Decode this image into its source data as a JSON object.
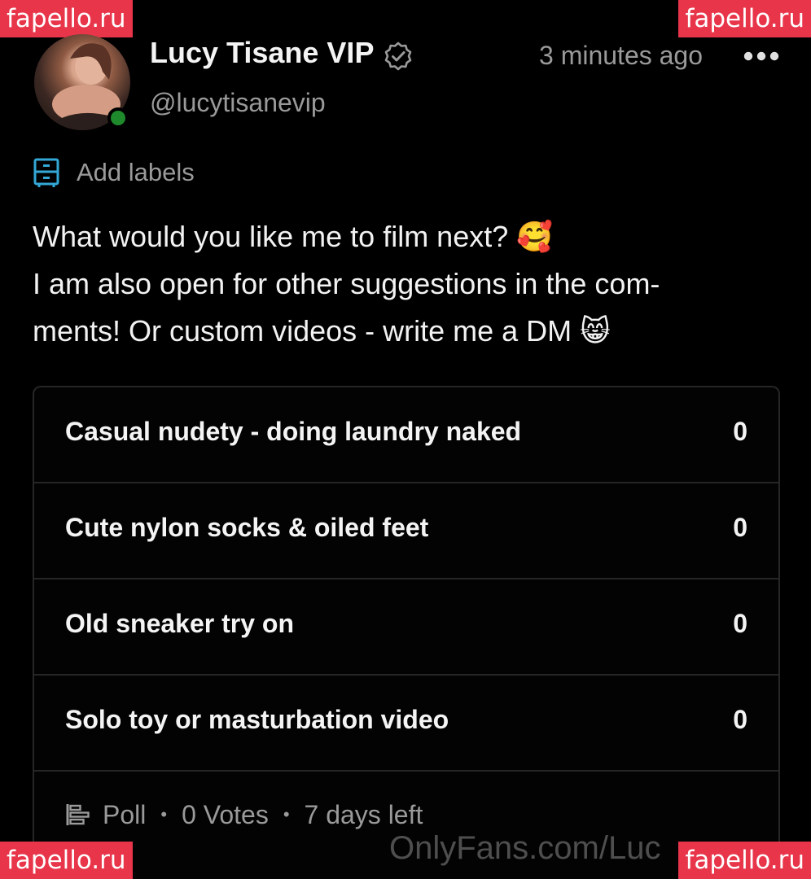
{
  "watermarks": {
    "top_left": "fapello.ru",
    "top_right": "fapello.ru",
    "bottom_left": "fapello.ru",
    "bottom_right": "fapello.ru",
    "site": "OnlyFans.com/Luc"
  },
  "post": {
    "author": {
      "name": "Lucy Tisane VIP",
      "handle": "@lucytisanevip",
      "verified": true,
      "online": true
    },
    "timestamp": "3 minutes ago",
    "more_icon": "more-horizontal-icon",
    "labels": {
      "icon": "label-list-icon",
      "text": "Add labels"
    },
    "text_lines": [
      "What would you like me to film next? 🥰",
      "I am also open for other suggestions in the com-",
      "ments! Or custom videos - write me a DM 😸"
    ]
  },
  "poll": {
    "options": [
      {
        "label": "Casual nudety - doing laundry naked",
        "count": "0"
      },
      {
        "label": "Cute nylon socks & oiled feet",
        "count": "0"
      },
      {
        "label": "Old sneaker try on",
        "count": "0"
      },
      {
        "label": "Solo toy or masturbation video",
        "count": "0"
      }
    ],
    "footer": {
      "type": "Poll",
      "votes": "0 Votes",
      "remaining": "7 days left",
      "separator": "•"
    }
  },
  "colors": {
    "background": "#000000",
    "text_primary": "#f2f2f2",
    "text_secondary": "#9a9a9a",
    "accent_icon": "#33a8d6",
    "online": "#1e8a2c",
    "watermark_bg": "#e8354a",
    "border": "#262626"
  }
}
